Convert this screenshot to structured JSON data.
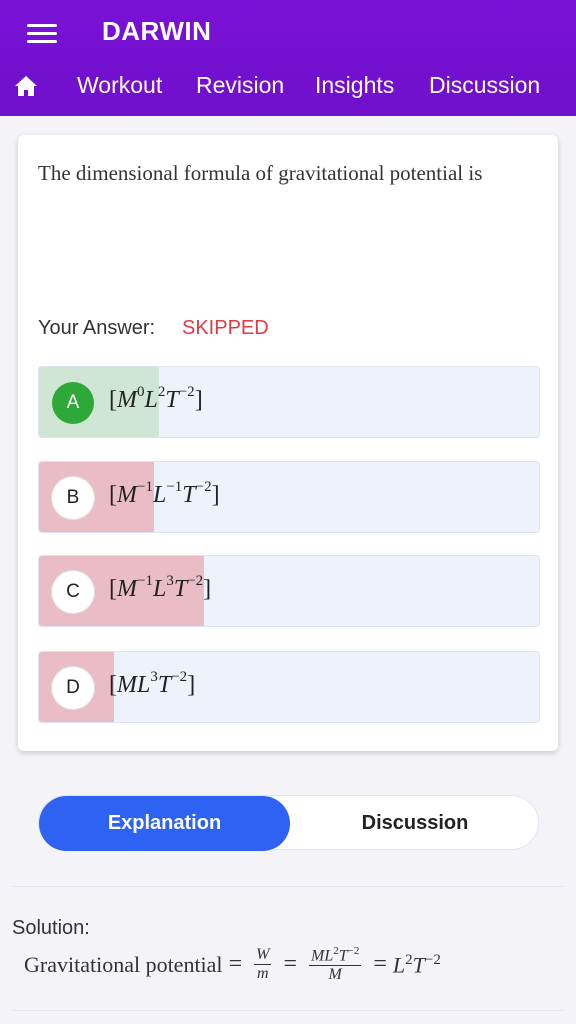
{
  "app": {
    "title": "DARWIN"
  },
  "nav": {
    "items": [
      {
        "label": "Workout"
      },
      {
        "label": "Revision"
      },
      {
        "label": "Insights"
      },
      {
        "label": "Discussion"
      }
    ]
  },
  "question": {
    "text": "The dimensional formula of gravitational potential is",
    "answer_label": "Your Answer:",
    "answer_value": "SKIPPED",
    "options": [
      {
        "letter": "A",
        "formula": "[M^0 L^2 T^-2]",
        "correct": true,
        "response_share": 0.24
      },
      {
        "letter": "B",
        "formula": "[M^-1 L^-1 T^-2]",
        "correct": false,
        "response_share": 0.23
      },
      {
        "letter": "C",
        "formula": "[M^-1 L^3 T^-2]",
        "correct": false,
        "response_share": 0.33
      },
      {
        "letter": "D",
        "formula": "[M L^3 T^-2]",
        "correct": false,
        "response_share": 0.15
      }
    ]
  },
  "tabs": {
    "active": "Explanation",
    "inactive": "Discussion"
  },
  "solution": {
    "title": "Solution:",
    "lead": "Gravitational potential",
    "expression": "W/m = ML^2T^-2/M = L^2T^-2"
  },
  "colors": {
    "header": "#7a11d6",
    "correct_fill": "#cfe6d4",
    "wrong_fill": "#e9bcc6",
    "correct_badge": "#2fa83a",
    "skipped": "#e03a44",
    "tab_active": "#2d62f3"
  },
  "icons": {
    "menu": "hamburger-icon",
    "home": "home-icon"
  }
}
